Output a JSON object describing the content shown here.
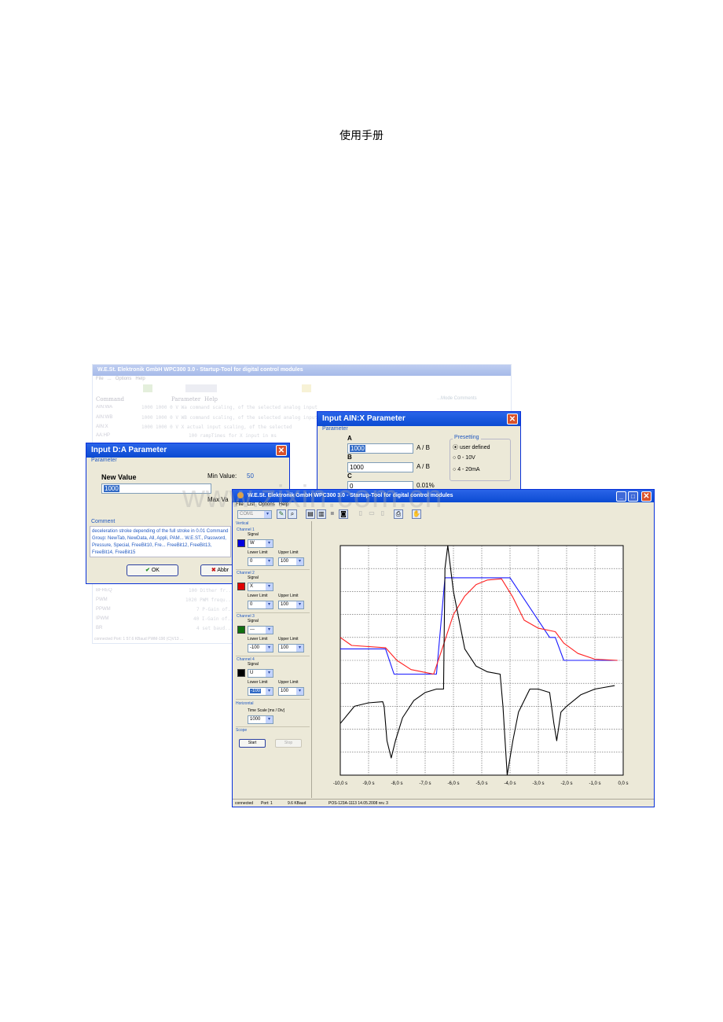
{
  "doc": {
    "title": "使用手册",
    "watermark": "www.zixin.com.cn"
  },
  "bg_window": {
    "title": "W.E.St. Elektronik GmbH   WPC300 3.0  - Startup-Tool for digital control modules",
    "menu": [
      "File",
      "...",
      "Options",
      "Help"
    ],
    "columns": {
      "command": "Command",
      "parameter": "Parameter",
      "help": "Help"
    },
    "right_hint": "...Mode Comments",
    "rows_top": [
      {
        "cmd": "AIN:WA",
        "vals": "1000   1000      0 V",
        "help": "Wa command scaling, of the selected analog input"
      },
      {
        "cmd": "AIN:WB",
        "vals": "1000   1000      0 V",
        "help": "WB command scaling, of the selected analog input"
      },
      {
        "cmd": "AIN:X",
        "vals": "1000   1000      0 V",
        "help": "X actual input scaling, of the selected"
      },
      {
        "cmd": "AA:HP",
        "vals": "100",
        "help": "rampTimes for X input in ms"
      }
    ],
    "rows_bottom": [
      {
        "cmd": "BFREQ",
        "vals": "100",
        "help": "Dither fr..."
      },
      {
        "cmd": "PWM",
        "vals": "1020",
        "help": "PWM frequ..."
      },
      {
        "cmd": "PPWM",
        "vals": "7",
        "help": "P-Gain of..."
      },
      {
        "cmd": "IPWM",
        "vals": "40",
        "help": "I-Gain of..."
      },
      {
        "cmd": "BR",
        "vals": "4",
        "help": "set baud..."
      }
    ],
    "status": "connected    Port: 1     57.6 KBaud         PWM-190 (C)V13 ..."
  },
  "dialog_da": {
    "title": "Input D:A Parameter",
    "group": "Parameter",
    "new_value_label": "New Value",
    "new_value": "1000",
    "min_label": "Min Value:",
    "min_value": "50",
    "max_label": "Max Va",
    "comment_label": "Comment",
    "comment_text": "deceleration stroke depending of the full stroke in 0.01 Command Group: NewTab, NewData, All, Appli, PAM... W.E.ST., Password, Pressure, Special, FreeBit10, Fre... FreeBit12, FreeBit13, FreeBit14, FreeBit15",
    "ok_label": "OK",
    "abort_label": "Abbr"
  },
  "dialog_ain": {
    "title": "Input AIN:X Parameter",
    "group": "Parameter",
    "a_label": "A",
    "a_value": "1000",
    "a_unit": "A / B",
    "b_label": "B",
    "b_value": "1000",
    "b_unit": "A / B",
    "c_label": "C",
    "c_value": "0",
    "c_unit": "0.01%",
    "preset_label": "Presetting",
    "presets": [
      "user defined",
      "0 - 10V",
      "4 - 20mA"
    ]
  },
  "scope": {
    "title": "W.E.St. Elektronik GmbH   WPC300 3.0  - Startup-Tool for digital control modules",
    "menu": [
      "File",
      "List",
      "Options",
      "Help"
    ],
    "port_combo": "COM1",
    "vertical": "Vertical",
    "channels": [
      {
        "name": "Channel 1",
        "signal": "W",
        "lower": "0",
        "upper": "100",
        "color": "#0000e0"
      },
      {
        "name": "Channel 2",
        "signal": "X",
        "lower": "0",
        "upper": "100",
        "color": "#e00000"
      },
      {
        "name": "Channel 3",
        "signal": "---",
        "lower": "-100",
        "upper": "100",
        "color": "#107010"
      },
      {
        "name": "Channel 4",
        "signal": "U",
        "lower": "-100",
        "upper": "100",
        "color": "#000000"
      }
    ],
    "signal_label": "Signal",
    "lower_label": "Lower Limit",
    "upper_label": "Upper Limit",
    "horizontal": "Horizontal",
    "time_scale_label": "Time Scale [ms / Div]",
    "time_scale": "1000",
    "scope_label": "Scope",
    "start_label": "Start",
    "stop_label": "Stop",
    "status": {
      "conn": "connected",
      "port": "Port: 1",
      "baud": "9.6 KBaud",
      "device": "POS-123A-1113 14.05.2008 rev. 3"
    }
  },
  "chart_data": {
    "type": "line",
    "x_tick_labels": [
      "-10,0 s",
      "-9,0 s",
      "-8,0 s",
      "-7,0 s",
      "-6,0 s",
      "-5,0 s",
      "-4,0 s",
      "-3,0 s",
      "-2,0 s",
      "-1,0 s",
      "0,0 s"
    ],
    "xlim": [
      -10,
      0
    ],
    "ylim": [
      -100,
      100
    ],
    "grid": true,
    "series": [
      {
        "color": "#1a1aff",
        "x": [
          -10,
          -8.4,
          -8.1,
          -6.9,
          -6.6,
          -6.3,
          -4.3,
          -4.0,
          -2.6,
          -2.4,
          -2.1,
          -0.2
        ],
        "y": [
          10,
          10,
          -12,
          -12,
          -12,
          72,
          72,
          72,
          20,
          20,
          0,
          0
        ]
      },
      {
        "color": "#ff2020",
        "x": [
          -10,
          -9.6,
          -8.4,
          -8.0,
          -7.5,
          -6.9,
          -6.7,
          -6.4,
          -6.0,
          -5.6,
          -5.2,
          -4.8,
          -4.3,
          -3.9,
          -3.5,
          -3.0,
          -2.4,
          -2.1,
          -1.6,
          -1.0,
          -0.2
        ],
        "y": [
          20,
          13,
          11,
          0,
          -8,
          -11,
          -12,
          10,
          40,
          56,
          66,
          70,
          71,
          55,
          35,
          28,
          25,
          15,
          6,
          1,
          0
        ]
      },
      {
        "color": "#000000",
        "x": [
          -10,
          -9.5,
          -9.0,
          -8.5,
          -8.45,
          -8.35,
          -8.2,
          -8.05,
          -7.8,
          -7.4,
          -7.0,
          -6.6,
          -6.35,
          -6.3,
          -6.2,
          -6.0,
          -5.6,
          -5.2,
          -4.8,
          -4.35,
          -4.25,
          -4.1,
          -3.9,
          -3.7,
          -3.3,
          -3.0,
          -2.6,
          -2.45,
          -2.35,
          -2.2,
          -2.0,
          -1.5,
          -1.0,
          -0.3
        ],
        "y": [
          -55,
          -40,
          -37,
          -36,
          -40,
          -70,
          -85,
          -70,
          -50,
          -35,
          -28,
          -25,
          -25,
          80,
          100,
          60,
          10,
          -5,
          -10,
          -12,
          -40,
          -100,
          -70,
          -45,
          -25,
          -25,
          -28,
          -55,
          -70,
          -45,
          -40,
          -30,
          -25,
          -22
        ]
      }
    ]
  }
}
